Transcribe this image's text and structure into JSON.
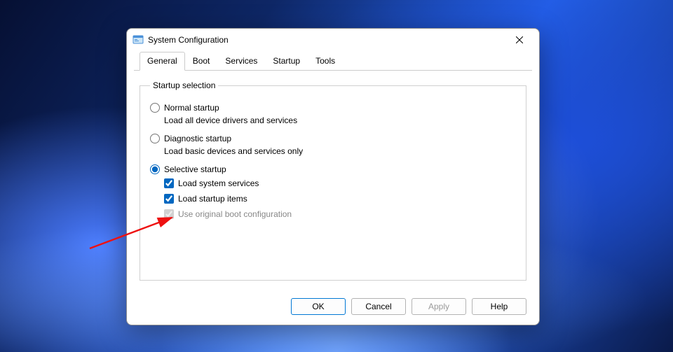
{
  "window": {
    "title": "System Configuration"
  },
  "tabs": [
    {
      "label": "General",
      "active": true
    },
    {
      "label": "Boot",
      "active": false
    },
    {
      "label": "Services",
      "active": false
    },
    {
      "label": "Startup",
      "active": false
    },
    {
      "label": "Tools",
      "active": false
    }
  ],
  "fieldset": {
    "legend": "Startup selection",
    "options": [
      {
        "id": "normal",
        "label": "Normal startup",
        "desc": "Load all device drivers and services",
        "checked": false
      },
      {
        "id": "diagnostic",
        "label": "Diagnostic startup",
        "desc": "Load basic devices and services only",
        "checked": false
      },
      {
        "id": "selective",
        "label": "Selective startup",
        "desc": null,
        "checked": true,
        "children": [
          {
            "label": "Load system services",
            "checked": true,
            "disabled": false
          },
          {
            "label": "Load startup items",
            "checked": true,
            "disabled": false
          },
          {
            "label": "Use original boot configuration",
            "checked": true,
            "disabled": true
          }
        ]
      }
    ]
  },
  "buttons": {
    "ok": "OK",
    "cancel": "Cancel",
    "apply": "Apply",
    "help": "Help"
  }
}
